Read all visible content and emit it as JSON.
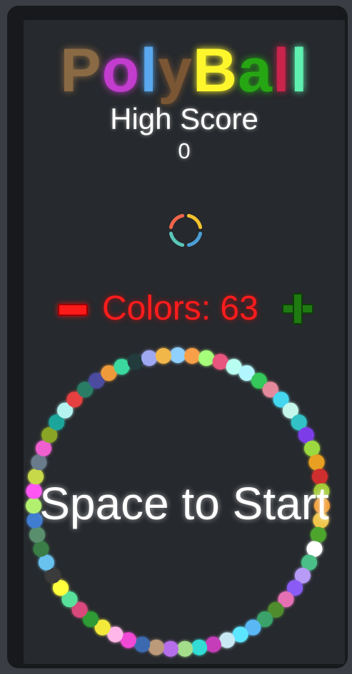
{
  "title": {
    "text": "PolyBall",
    "letters": [
      {
        "char": "P",
        "color": "#8a6a44"
      },
      {
        "char": "o",
        "color": "#c23ccd"
      },
      {
        "char": "l",
        "color": "#5aa8ee"
      },
      {
        "char": "y",
        "color": "#7a5634"
      },
      {
        "char": "B",
        "color": "#fdf62c"
      },
      {
        "char": "a",
        "color": "#26a613"
      },
      {
        "char": "l",
        "color": "#c8244c"
      },
      {
        "char": "l",
        "color": "#5ff0b0"
      }
    ]
  },
  "high_score": {
    "label": "High Score",
    "value": "0"
  },
  "color_control": {
    "text": "Colors: 63",
    "count": 63,
    "decrease_icon": "minus-icon",
    "increase_icon": "plus-icon",
    "text_color": "#ff1c1c",
    "minus_color": "#ff1a1a",
    "plus_color": "#1f7a11"
  },
  "preview_ring_colors": [
    "#f3c32c",
    "#4b9fd8",
    "#5ac6b8",
    "#f1654a"
  ],
  "ring_colors": [
    "#8fd0ff",
    "#f7a04a",
    "#a6ff7a",
    "#e8557e",
    "#b9fff1",
    "#b2f6ff",
    "#34c85a",
    "#e58a9c",
    "#44d6f0",
    "#c4f7ea",
    "#33c1c5",
    "#7b3ee9",
    "#9cd83f",
    "#e9a020",
    "#cf2d2d",
    "#a1c935",
    "#f2a03a",
    "#f0c64c",
    "#4ea52e",
    "#ffffff",
    "#4bbf88",
    "#b89af7",
    "#8a5cf5",
    "#e66fb4",
    "#4f8c2f",
    "#3aa36a",
    "#5ab8f5",
    "#5ce5ff",
    "#c8e9f3",
    "#c53eb8",
    "#33dcd5",
    "#a4de8b",
    "#b66eea",
    "#bb9a7a",
    "#3b6ab0",
    "#f14ad5",
    "#ffb6e8",
    "#f2e93a",
    "#2f9b36",
    "#d94a7c",
    "#58e19b",
    "#ffff3c",
    "#3b3b3b",
    "#69c1ee",
    "#3b7d46",
    "#5a8f6e",
    "#3f7bd0",
    "#b3f070",
    "#ff55f2",
    "#c7d94a",
    "#6b7b8c",
    "#ef5fd0",
    "#8aa527",
    "#1fa59a",
    "#b5f3f1",
    "#e63f3f",
    "#2b7d65",
    "#4c4ca0",
    "#ee9a3b",
    "#3ad99f",
    "#223b3d",
    "#9fa9f2",
    "#f2b74a"
  ],
  "start_prompt": "Space to Start"
}
